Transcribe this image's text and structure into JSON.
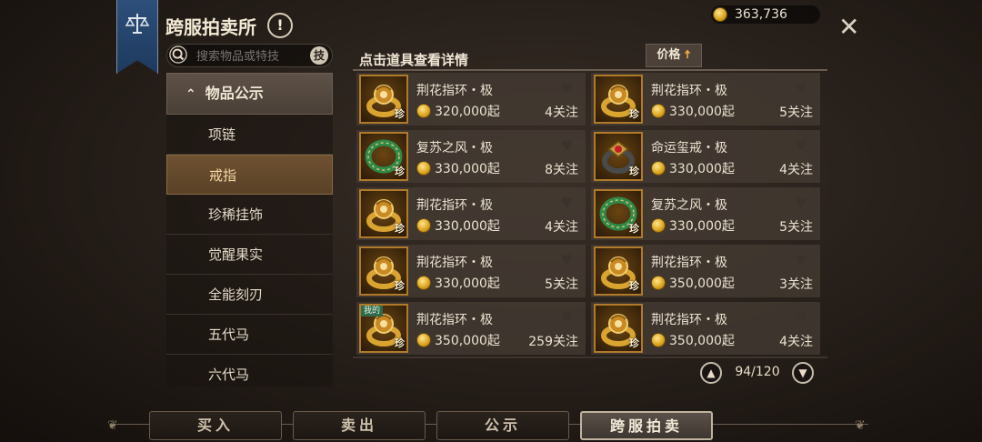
{
  "header": {
    "title": "跨服拍卖所",
    "gold": "363,736"
  },
  "search": {
    "placeholder": "搜索物品或特技",
    "skill_badge": "技"
  },
  "sidebar": {
    "category": "物品公示",
    "items": [
      {
        "label": "项链",
        "active": false
      },
      {
        "label": "戒指",
        "active": true
      },
      {
        "label": "珍稀挂饰",
        "active": false
      },
      {
        "label": "觉醒果实",
        "active": false
      },
      {
        "label": "全能刻刃",
        "active": false
      },
      {
        "label": "五代马",
        "active": false
      },
      {
        "label": "六代马",
        "active": false
      }
    ]
  },
  "list": {
    "title": "点击道具查看详情",
    "sort_label": "价格",
    "rare_badge": "珍",
    "mine_badge": "我的",
    "items": [
      {
        "name": "荆花指环・极",
        "price": "320,000起",
        "watchers": "4关注",
        "icon": "gold-flower-ring-icon",
        "mine": false
      },
      {
        "name": "荆花指环・极",
        "price": "330,000起",
        "watchers": "5关注",
        "icon": "gold-flower-ring-icon",
        "mine": false
      },
      {
        "name": "复苏之风・极",
        "price": "330,000起",
        "watchers": "8关注",
        "icon": "jade-ring-icon",
        "mine": false
      },
      {
        "name": "命运玺戒・极",
        "price": "330,000起",
        "watchers": "4关注",
        "icon": "ruby-seal-ring-icon",
        "mine": false
      },
      {
        "name": "荆花指环・极",
        "price": "330,000起",
        "watchers": "4关注",
        "icon": "gold-flower-ring-icon",
        "mine": false
      },
      {
        "name": "复苏之风・极",
        "price": "330,000起",
        "watchers": "5关注",
        "icon": "jade-ring-icon",
        "mine": false
      },
      {
        "name": "荆花指环・极",
        "price": "330,000起",
        "watchers": "5关注",
        "icon": "gold-flower-ring-icon",
        "mine": false
      },
      {
        "name": "荆花指环・极",
        "price": "350,000起",
        "watchers": "3关注",
        "icon": "gold-flower-ring-icon",
        "mine": false
      },
      {
        "name": "荆花指环・极",
        "price": "350,000起",
        "watchers": "259关注",
        "icon": "gold-flower-ring-icon",
        "mine": true
      },
      {
        "name": "荆花指环・极",
        "price": "350,000起",
        "watchers": "4关注",
        "icon": "gold-flower-ring-icon",
        "mine": false
      }
    ]
  },
  "pager": {
    "text": "94/120"
  },
  "tabs": [
    {
      "label": "买入",
      "active": false
    },
    {
      "label": "卖出",
      "active": false
    },
    {
      "label": "公示",
      "active": false
    },
    {
      "label": "跨服拍卖",
      "active": true
    }
  ]
}
